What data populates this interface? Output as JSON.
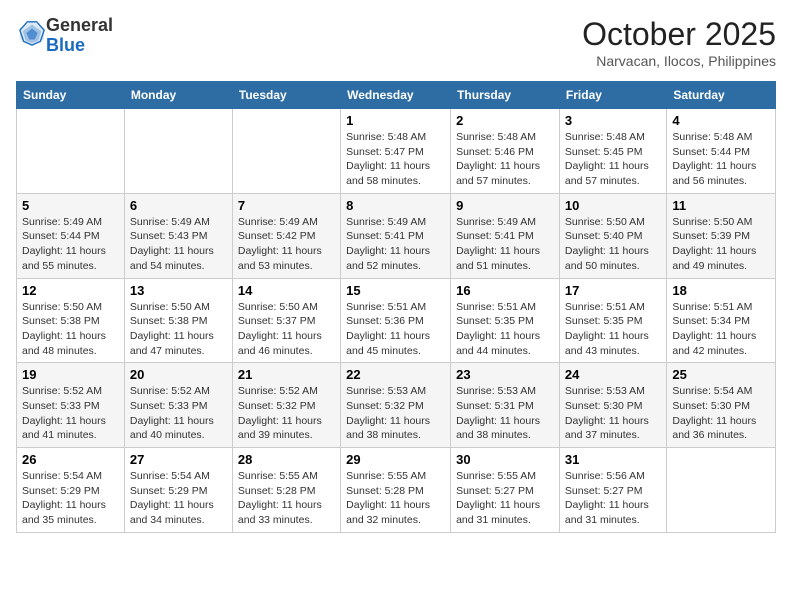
{
  "header": {
    "logo_general": "General",
    "logo_blue": "Blue",
    "month_title": "October 2025",
    "location": "Narvacan, Ilocos, Philippines"
  },
  "days_of_week": [
    "Sunday",
    "Monday",
    "Tuesday",
    "Wednesday",
    "Thursday",
    "Friday",
    "Saturday"
  ],
  "weeks": [
    [
      {
        "day": "",
        "info": ""
      },
      {
        "day": "",
        "info": ""
      },
      {
        "day": "",
        "info": ""
      },
      {
        "day": "1",
        "info": "Sunrise: 5:48 AM\nSunset: 5:47 PM\nDaylight: 11 hours\nand 58 minutes."
      },
      {
        "day": "2",
        "info": "Sunrise: 5:48 AM\nSunset: 5:46 PM\nDaylight: 11 hours\nand 57 minutes."
      },
      {
        "day": "3",
        "info": "Sunrise: 5:48 AM\nSunset: 5:45 PM\nDaylight: 11 hours\nand 57 minutes."
      },
      {
        "day": "4",
        "info": "Sunrise: 5:48 AM\nSunset: 5:44 PM\nDaylight: 11 hours\nand 56 minutes."
      }
    ],
    [
      {
        "day": "5",
        "info": "Sunrise: 5:49 AM\nSunset: 5:44 PM\nDaylight: 11 hours\nand 55 minutes."
      },
      {
        "day": "6",
        "info": "Sunrise: 5:49 AM\nSunset: 5:43 PM\nDaylight: 11 hours\nand 54 minutes."
      },
      {
        "day": "7",
        "info": "Sunrise: 5:49 AM\nSunset: 5:42 PM\nDaylight: 11 hours\nand 53 minutes."
      },
      {
        "day": "8",
        "info": "Sunrise: 5:49 AM\nSunset: 5:41 PM\nDaylight: 11 hours\nand 52 minutes."
      },
      {
        "day": "9",
        "info": "Sunrise: 5:49 AM\nSunset: 5:41 PM\nDaylight: 11 hours\nand 51 minutes."
      },
      {
        "day": "10",
        "info": "Sunrise: 5:50 AM\nSunset: 5:40 PM\nDaylight: 11 hours\nand 50 minutes."
      },
      {
        "day": "11",
        "info": "Sunrise: 5:50 AM\nSunset: 5:39 PM\nDaylight: 11 hours\nand 49 minutes."
      }
    ],
    [
      {
        "day": "12",
        "info": "Sunrise: 5:50 AM\nSunset: 5:38 PM\nDaylight: 11 hours\nand 48 minutes."
      },
      {
        "day": "13",
        "info": "Sunrise: 5:50 AM\nSunset: 5:38 PM\nDaylight: 11 hours\nand 47 minutes."
      },
      {
        "day": "14",
        "info": "Sunrise: 5:50 AM\nSunset: 5:37 PM\nDaylight: 11 hours\nand 46 minutes."
      },
      {
        "day": "15",
        "info": "Sunrise: 5:51 AM\nSunset: 5:36 PM\nDaylight: 11 hours\nand 45 minutes."
      },
      {
        "day": "16",
        "info": "Sunrise: 5:51 AM\nSunset: 5:35 PM\nDaylight: 11 hours\nand 44 minutes."
      },
      {
        "day": "17",
        "info": "Sunrise: 5:51 AM\nSunset: 5:35 PM\nDaylight: 11 hours\nand 43 minutes."
      },
      {
        "day": "18",
        "info": "Sunrise: 5:51 AM\nSunset: 5:34 PM\nDaylight: 11 hours\nand 42 minutes."
      }
    ],
    [
      {
        "day": "19",
        "info": "Sunrise: 5:52 AM\nSunset: 5:33 PM\nDaylight: 11 hours\nand 41 minutes."
      },
      {
        "day": "20",
        "info": "Sunrise: 5:52 AM\nSunset: 5:33 PM\nDaylight: 11 hours\nand 40 minutes."
      },
      {
        "day": "21",
        "info": "Sunrise: 5:52 AM\nSunset: 5:32 PM\nDaylight: 11 hours\nand 39 minutes."
      },
      {
        "day": "22",
        "info": "Sunrise: 5:53 AM\nSunset: 5:32 PM\nDaylight: 11 hours\nand 38 minutes."
      },
      {
        "day": "23",
        "info": "Sunrise: 5:53 AM\nSunset: 5:31 PM\nDaylight: 11 hours\nand 38 minutes."
      },
      {
        "day": "24",
        "info": "Sunrise: 5:53 AM\nSunset: 5:30 PM\nDaylight: 11 hours\nand 37 minutes."
      },
      {
        "day": "25",
        "info": "Sunrise: 5:54 AM\nSunset: 5:30 PM\nDaylight: 11 hours\nand 36 minutes."
      }
    ],
    [
      {
        "day": "26",
        "info": "Sunrise: 5:54 AM\nSunset: 5:29 PM\nDaylight: 11 hours\nand 35 minutes."
      },
      {
        "day": "27",
        "info": "Sunrise: 5:54 AM\nSunset: 5:29 PM\nDaylight: 11 hours\nand 34 minutes."
      },
      {
        "day": "28",
        "info": "Sunrise: 5:55 AM\nSunset: 5:28 PM\nDaylight: 11 hours\nand 33 minutes."
      },
      {
        "day": "29",
        "info": "Sunrise: 5:55 AM\nSunset: 5:28 PM\nDaylight: 11 hours\nand 32 minutes."
      },
      {
        "day": "30",
        "info": "Sunrise: 5:55 AM\nSunset: 5:27 PM\nDaylight: 11 hours\nand 31 minutes."
      },
      {
        "day": "31",
        "info": "Sunrise: 5:56 AM\nSunset: 5:27 PM\nDaylight: 11 hours\nand 31 minutes."
      },
      {
        "day": "",
        "info": ""
      }
    ]
  ]
}
